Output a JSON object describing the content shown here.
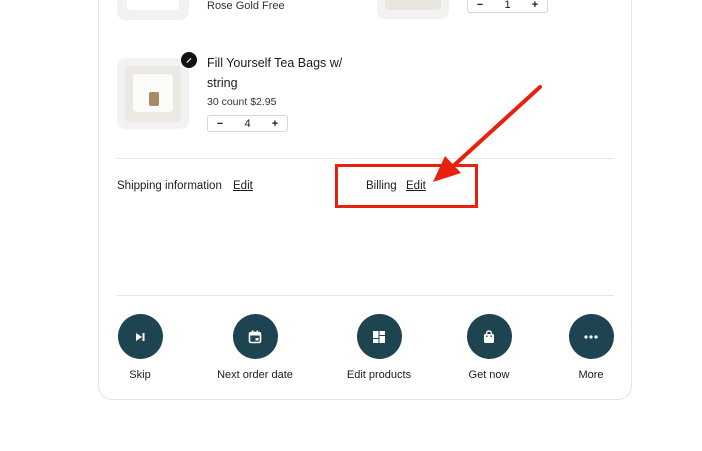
{
  "items": [
    {
      "variant": "Rose Gold Free",
      "quantity": "1"
    },
    {
      "title_line1": "Fill Yourself Tea Bags w/",
      "title_line2": "string",
      "details": "30 count $2.95",
      "quantity": "4"
    }
  ],
  "stepper": {
    "minus": "−",
    "plus": "+"
  },
  "shipping": {
    "label": "Shipping information",
    "edit": "Edit"
  },
  "billing": {
    "label": "Billing",
    "edit": "Edit"
  },
  "actions": {
    "skip": "Skip",
    "next_order_date": "Next order date",
    "edit_products": "Edit products",
    "get_now": "Get now",
    "more": "More"
  },
  "colors": {
    "accent": "#1f4451",
    "annotation": "#e8210f"
  }
}
